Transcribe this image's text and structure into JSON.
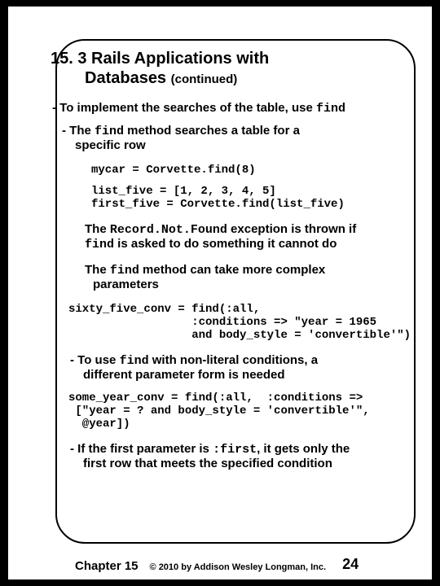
{
  "title_line1": "15. 3 Rails Applications with",
  "title_line2": "Databases",
  "title_cont": "(continued)",
  "bullet1_pre": "- To implement the searches of the table, use ",
  "bullet1_code": "find",
  "bullet2_pre": "- The ",
  "bullet2_code": "find",
  "bullet2_post": " method searches a table for a",
  "bullet2_line2": "specific row",
  "code1": "mycar = Corvette.find(8)",
  "code2": "list_five = [1, 2, 3, 4, 5]\nfirst_five = Corvette.find(list_five)",
  "para1_pre": "The ",
  "para1_code1": "Record.Not.Found",
  "para1_mid": " exception is thrown if",
  "para1_code2": "find",
  "para1_post": " is asked to do something it cannot do",
  "para2_pre": "The ",
  "para2_code": "find",
  "para2_post": " method can take more complex",
  "para2_line2": "parameters",
  "code3": "sixty_five_conv = find(:all,\n                  :conditions => \"year = 1965\n                  and body_style = 'convertible'\")",
  "bullet3_pre": "- To use ",
  "bullet3_code": "find",
  "bullet3_post": " with non-literal conditions, a",
  "bullet3_line2": "different parameter form is needed",
  "code4": "some_year_conv = find(:all,  :conditions =>\n [\"year = ? and body_style = 'convertible'\",\n  @year])",
  "bullet4_pre": "- If the first parameter is ",
  "bullet4_code": ":first",
  "bullet4_post": ", it gets only the",
  "bullet4_line2": "first row that meets the specified condition",
  "footer": {
    "chapter": "Chapter 15",
    "copyright": "© 2010 by Addison Wesley Longman, Inc.",
    "page": "24"
  }
}
